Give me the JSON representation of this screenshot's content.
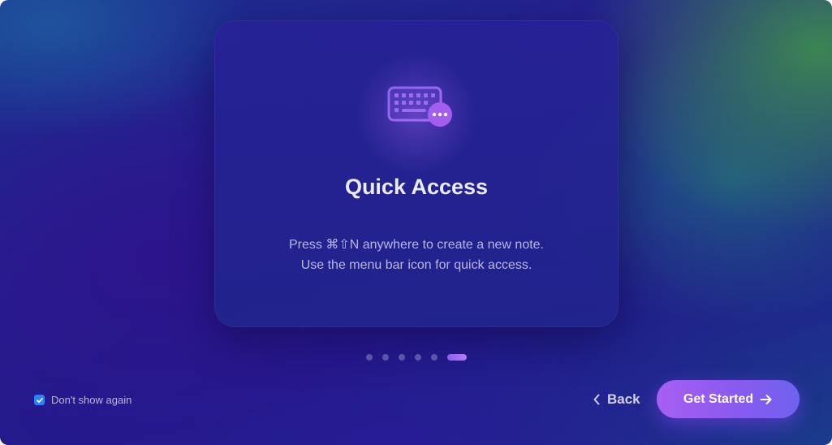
{
  "card": {
    "icon": "keyboard-with-ellipsis-icon",
    "title": "Quick Access",
    "description_line1": "Press ⌘⇧N anywhere to create a new note.",
    "description_line2": "Use the menu bar icon for quick access."
  },
  "pagination": {
    "total_pages": 6,
    "current_page": 6
  },
  "footer": {
    "dont_show_again_label": "Don't show again",
    "dont_show_again_checked": true,
    "back_label": "Back",
    "get_started_label": "Get Started"
  },
  "colors": {
    "accent_purple": "#a85ef2",
    "accent_indigo": "#6f62ee",
    "checkbox_blue": "#2f7ff5"
  }
}
